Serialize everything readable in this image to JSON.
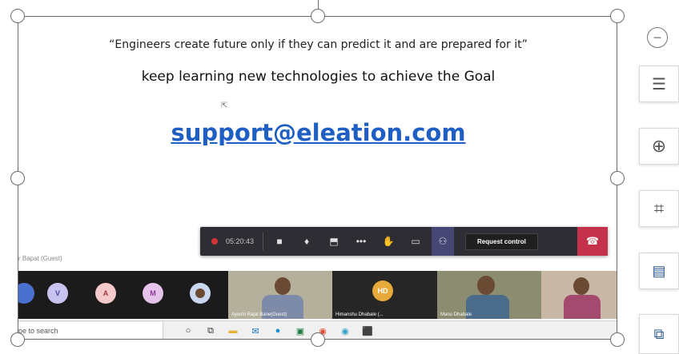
{
  "slide": {
    "quote": "“Engineers create future only if they can predict it and are prepared for it”",
    "tagline": "keep learning new technologies to achieve the Goal",
    "email": "support@eleation.com",
    "guest_label": "r Bapat (Guest)"
  },
  "meeting_toolbar": {
    "timer": "05:20:43",
    "request_control_label": "Request control",
    "icons": [
      "camera-icon",
      "microphone-icon",
      "share-screen-icon",
      "more-icon",
      "raise-hand-icon",
      "chat-icon",
      "participants-icon",
      "hang-up-icon"
    ]
  },
  "participants": {
    "avatars": [
      {
        "initial": "V",
        "bg": "#c9c3f0",
        "fg": "#4a3f9c"
      },
      {
        "initial": "A",
        "bg": "#f4c9c9",
        "fg": "#a33b3b"
      },
      {
        "initial": "M",
        "bg": "#e6c3ea",
        "fg": "#8a3a96"
      }
    ],
    "tiles": [
      {
        "name": "Ayushi Rajat Bane(Guest)"
      },
      {
        "initial": "HD",
        "name": "Himanshu Dhabale (..."
      },
      {
        "name": "Manu Dhabale"
      },
      {
        "name": ""
      }
    ]
  },
  "taskbar": {
    "search_placeholder": "pe to search",
    "icons": [
      "cortana-icon",
      "task-view-icon",
      "file-explorer-icon",
      "mail-icon",
      "edge-icon",
      "excel-icon",
      "chrome-icon",
      "chrome-alt-icon",
      "teams-icon"
    ]
  },
  "side_pane": {
    "icons": [
      "collapse-icon",
      "wrap-text-icon",
      "zoom-icon",
      "crop-icon",
      "word-convert-icon",
      "replace-icon"
    ]
  },
  "colors": {
    "accent_link": "#1f5fc4",
    "toolbar_bg": "#2d2d33",
    "hangup": "#c4314b"
  }
}
